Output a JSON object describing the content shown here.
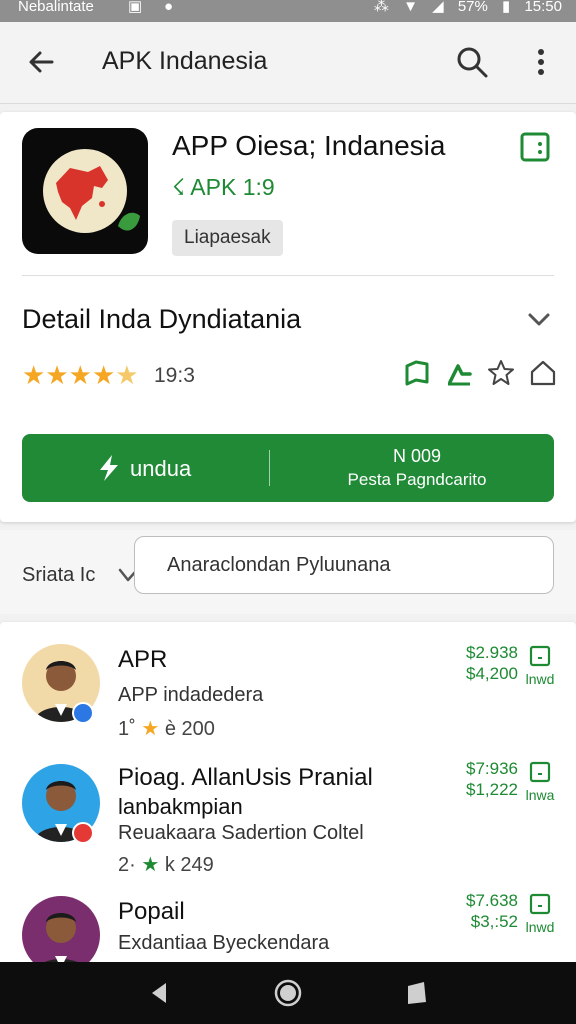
{
  "status_bar": {
    "left_text": "Nebalintate",
    "battery": "57%",
    "time": "15:50"
  },
  "app_bar": {
    "title": "APK Indanesia"
  },
  "app": {
    "name": "APP Oiesa; Indanesia",
    "version": "☇ APK 1:9",
    "chip": "Liapaesak"
  },
  "detail": {
    "title": "Detail Inda Dyndiatania",
    "rating_text": "19:3",
    "rating_value_stars": 4.5
  },
  "download": {
    "label": "undua",
    "size": "N 009",
    "subtitle": "Pesta Pagndcarito"
  },
  "review": {
    "label": "Sriata Ic",
    "placeholder": "Anaraclondan Pyluunana"
  },
  "list": [
    {
      "name": "APR",
      "sub": "APP indadedera",
      "meta_prefix": "1˚",
      "meta_star": "★",
      "meta_count": "è 200",
      "price_top": "$2.938",
      "price_bottom": "$4,200",
      "dl_label": "lnwd",
      "badge_color": "#2b78e4",
      "avatar_bg": "#f2d9a8"
    },
    {
      "name": "Pioag. AllanUsis Pranial",
      "name2": "lanbakmpian",
      "sub": "Reuakaara Sadertion Coltel",
      "meta_prefix": "2·",
      "meta_star": "★",
      "meta_count": "k 249",
      "price_top": "$7:936",
      "price_bottom": "$1,222",
      "dl_label": "lnwa",
      "badge_color": "#e53935",
      "avatar_bg": "#2ea3e6"
    },
    {
      "name": "Popail",
      "sub": "Exdantiaa Byeckendara",
      "price_top": "$7.638",
      "price_bottom": "$3,:52",
      "dl_label": "lnwd",
      "avatar_bg": "#7b2e6e"
    }
  ],
  "colors": {
    "accent_green": "#208a36",
    "star": "#f5a623",
    "nav": "#0d0d0d"
  }
}
